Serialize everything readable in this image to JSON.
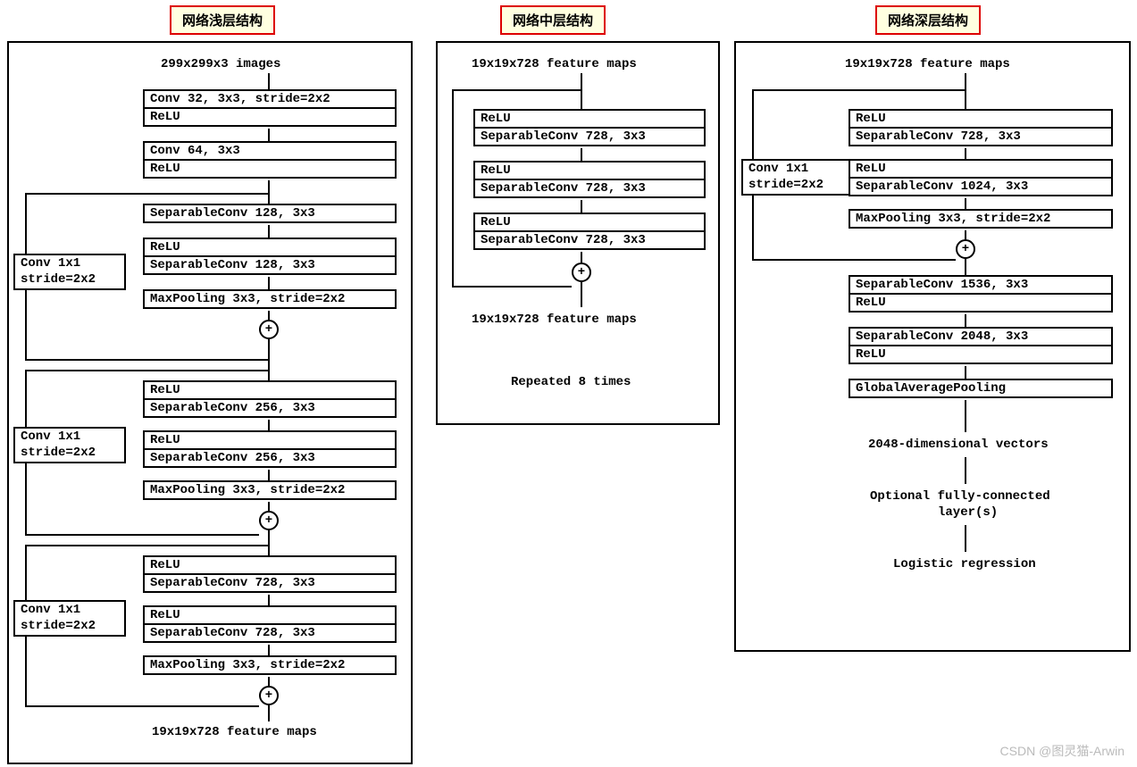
{
  "watermark": "CSDN @图灵猫-Arwin",
  "entry": {
    "title": "网络浅层结构",
    "input": "299x299x3 images",
    "conv1": {
      "a": "Conv 32, 3x3, stride=2x2",
      "b": "ReLU"
    },
    "conv2": {
      "a": "Conv 64, 3x3",
      "b": "ReLU"
    },
    "b1": {
      "side_a": "Conv 1x1",
      "side_b": "stride=2x2",
      "r1": "SeparableConv 128, 3x3",
      "r2a": "ReLU",
      "r2b": "SeparableConv 128, 3x3",
      "r3": "MaxPooling 3x3, stride=2x2"
    },
    "b2": {
      "side_a": "Conv 1x1",
      "side_b": "stride=2x2",
      "r1a": "ReLU",
      "r1b": "SeparableConv 256, 3x3",
      "r2a": "ReLU",
      "r2b": "SeparableConv 256, 3x3",
      "r3": "MaxPooling 3x3, stride=2x2"
    },
    "b3": {
      "side_a": "Conv 1x1",
      "side_b": "stride=2x2",
      "r1a": "ReLU",
      "r1b": "SeparableConv 728, 3x3",
      "r2a": "ReLU",
      "r2b": "SeparableConv 728, 3x3",
      "r3": "MaxPooling 3x3, stride=2x2"
    },
    "out": "19x19x728 feature maps",
    "plus": "+"
  },
  "middle": {
    "title": "网络中层结构",
    "input": "19x19x728 feature maps",
    "r1a": "ReLU",
    "r1b": "SeparableConv 728, 3x3",
    "r2a": "ReLU",
    "r2b": "SeparableConv 728, 3x3",
    "r3a": "ReLU",
    "r3b": "SeparableConv 728, 3x3",
    "out": "19x19x728 feature maps",
    "note": "Repeated 8 times"
  },
  "exit": {
    "title": "网络深层结构",
    "input": "19x19x728 feature maps",
    "side_a": "Conv 1x1",
    "side_b": "stride=2x2",
    "r1a": "ReLU",
    "r1b": "SeparableConv 728, 3x3",
    "r2a": "ReLU",
    "r2b": "SeparableConv 1024, 3x3",
    "r3": "MaxPooling 3x3, stride=2x2",
    "s1a": "SeparableConv 1536, 3x3",
    "s1b": "ReLU",
    "s2a": "SeparableConv 2048, 3x3",
    "s2b": "ReLU",
    "gap": "GlobalAveragePooling",
    "vec": "2048-dimensional vectors",
    "fc1": "Optional fully-connected",
    "fc2": "layer(s)",
    "lr": "Logistic regression"
  }
}
